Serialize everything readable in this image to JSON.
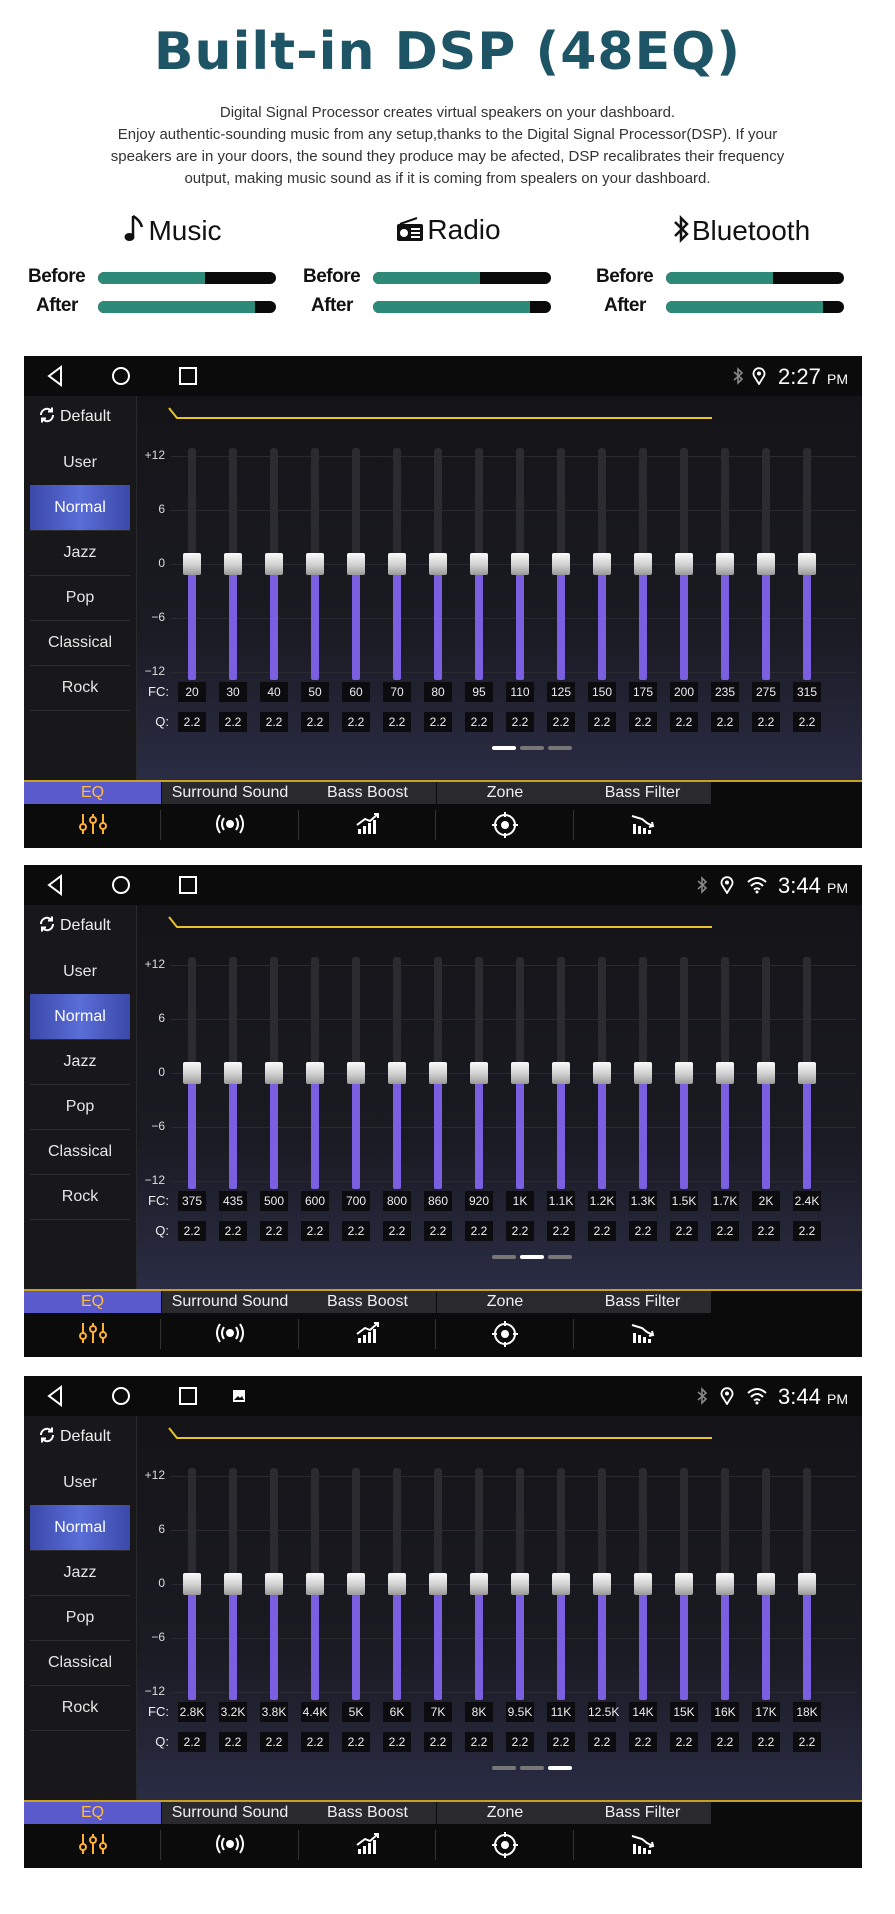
{
  "title": "Built-in DSP (48EQ)",
  "intro": [
    "Digital Signal Processor creates virtual speakers on your dashboard.",
    "Enjoy authentic-sounding music from any setup,thanks to the Digital Signal Processor(DSP). If your",
    "speakers are in your doors, the sound they produce may be afected, DSP recalibrates their frequency",
    "output, making music sound as if it is coming from spealers on your dashboard."
  ],
  "comparisons": [
    {
      "label": "Music",
      "icon": "music-note-icon",
      "before_label": "Before",
      "after_label": "After",
      "before": 0.6,
      "after": 0.88
    },
    {
      "label": "Radio",
      "icon": "radio-icon",
      "before_label": "Before",
      "after_label": "After",
      "before": 0.6,
      "after": 0.88
    },
    {
      "label": "Bluetooth",
      "icon": "bluetooth-icon",
      "before_label": "Before",
      "after_label": "After",
      "before": 0.6,
      "after": 0.88
    }
  ],
  "colors": {
    "title": "#1e5566",
    "fill": "#2e8a78",
    "selected": "#5a6ed8",
    "slider": "#7a60e0",
    "curve": "#e6c42a",
    "tab_active_text": "#ffbd40"
  },
  "presets": [
    "User",
    "Normal",
    "Jazz",
    "Pop",
    "Classical",
    "Rock"
  ],
  "selected_preset": "Normal",
  "default_label": "Default",
  "y_ticks": [
    "+12",
    "6",
    "0",
    "−6",
    "−12"
  ],
  "fc_label": "FC:",
  "q_label": "Q:",
  "tabs": [
    {
      "label": "EQ",
      "icon": "equalizer-icon"
    },
    {
      "label": "Surround Sound",
      "icon": "surround-icon"
    },
    {
      "label": "Bass Boost",
      "icon": "bass-boost-icon"
    },
    {
      "label": "Zone",
      "icon": "zone-icon"
    },
    {
      "label": "Bass Filter",
      "icon": "bass-filter-icon"
    }
  ],
  "active_tab": "EQ",
  "screens": [
    {
      "time": "2:27",
      "ampm": "PM",
      "status_icons": [
        "bluetooth-icon",
        "location-icon"
      ],
      "extra_nav_icon": false,
      "active_page": 0,
      "fc": [
        "20",
        "30",
        "40",
        "50",
        "60",
        "70",
        "80",
        "95",
        "110",
        "125",
        "150",
        "175",
        "200",
        "235",
        "275",
        "315"
      ],
      "q": [
        "2.2",
        "2.2",
        "2.2",
        "2.2",
        "2.2",
        "2.2",
        "2.2",
        "2.2",
        "2.2",
        "2.2",
        "2.2",
        "2.2",
        "2.2",
        "2.2",
        "2.2",
        "2.2"
      ],
      "gains_db": [
        0,
        0,
        0,
        0,
        0,
        0,
        0,
        0,
        0,
        0,
        0,
        0,
        0,
        0,
        0,
        0
      ]
    },
    {
      "time": "3:44",
      "ampm": "PM",
      "status_icons": [
        "bluetooth-icon",
        "location-icon",
        "wifi-icon"
      ],
      "extra_nav_icon": false,
      "active_page": 1,
      "fc": [
        "375",
        "435",
        "500",
        "600",
        "700",
        "800",
        "860",
        "920",
        "1K",
        "1.1K",
        "1.2K",
        "1.3K",
        "1.5K",
        "1.7K",
        "2K",
        "2.4K"
      ],
      "q": [
        "2.2",
        "2.2",
        "2.2",
        "2.2",
        "2.2",
        "2.2",
        "2.2",
        "2.2",
        "2.2",
        "2.2",
        "2.2",
        "2.2",
        "2.2",
        "2.2",
        "2.2",
        "2.2"
      ],
      "gains_db": [
        0,
        0,
        0,
        0,
        0,
        0,
        0,
        0,
        0,
        0,
        0,
        0,
        0,
        0,
        0,
        0
      ]
    },
    {
      "time": "3:44",
      "ampm": "PM",
      "status_icons": [
        "bluetooth-icon",
        "location-icon",
        "wifi-icon"
      ],
      "extra_nav_icon": true,
      "active_page": 2,
      "fc": [
        "2.8K",
        "3.2K",
        "3.8K",
        "4.4K",
        "5K",
        "6K",
        "7K",
        "8K",
        "9.5K",
        "11K",
        "12.5K",
        "14K",
        "15K",
        "16K",
        "17K",
        "18K"
      ],
      "q": [
        "2.2",
        "2.2",
        "2.2",
        "2.2",
        "2.2",
        "2.2",
        "2.2",
        "2.2",
        "2.2",
        "2.2",
        "2.2",
        "2.2",
        "2.2",
        "2.2",
        "2.2",
        "2.2"
      ],
      "gains_db": [
        0,
        0,
        0,
        0,
        0,
        0,
        0,
        0,
        0,
        0,
        0,
        0,
        0,
        0,
        0,
        0
      ]
    }
  ]
}
